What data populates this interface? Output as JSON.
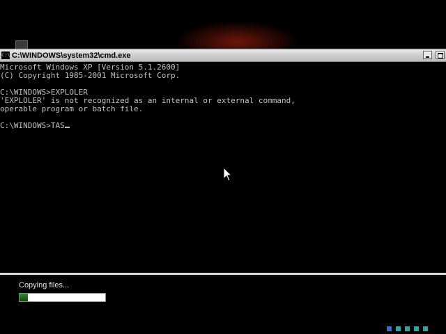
{
  "window": {
    "title": "C:\\WINDOWS\\system32\\cmd.exe",
    "icon_name": "cmd-icon",
    "icon_text": "c:\\"
  },
  "console": {
    "lines": [
      "Microsoft Windows XP [Version 5.1.2600]",
      "(C) Copyright 1985-2001 Microsoft Corp.",
      "",
      "C:\\WINDOWS>EXPLOLER",
      "'EXPLOLER' is not recognized as an internal or external command,",
      "operable program or batch file.",
      "",
      "C:\\WINDOWS>TAS"
    ],
    "text_color": "#c0c0c0",
    "background": "#000000"
  },
  "setup": {
    "status_text": "Copying files...",
    "progress_fraction": 0.1,
    "progress_color": "#1a6b1a"
  },
  "loading_dots": {
    "colors": [
      "#2f6fe0",
      "#2aa7a0",
      "#2aa7a0",
      "#2aa7a0",
      "#2aa7a0"
    ]
  },
  "icons": {
    "mouse_pointer": "mouse-pointer-icon",
    "minimize": "minimize-icon",
    "maximize": "maximize-icon"
  }
}
